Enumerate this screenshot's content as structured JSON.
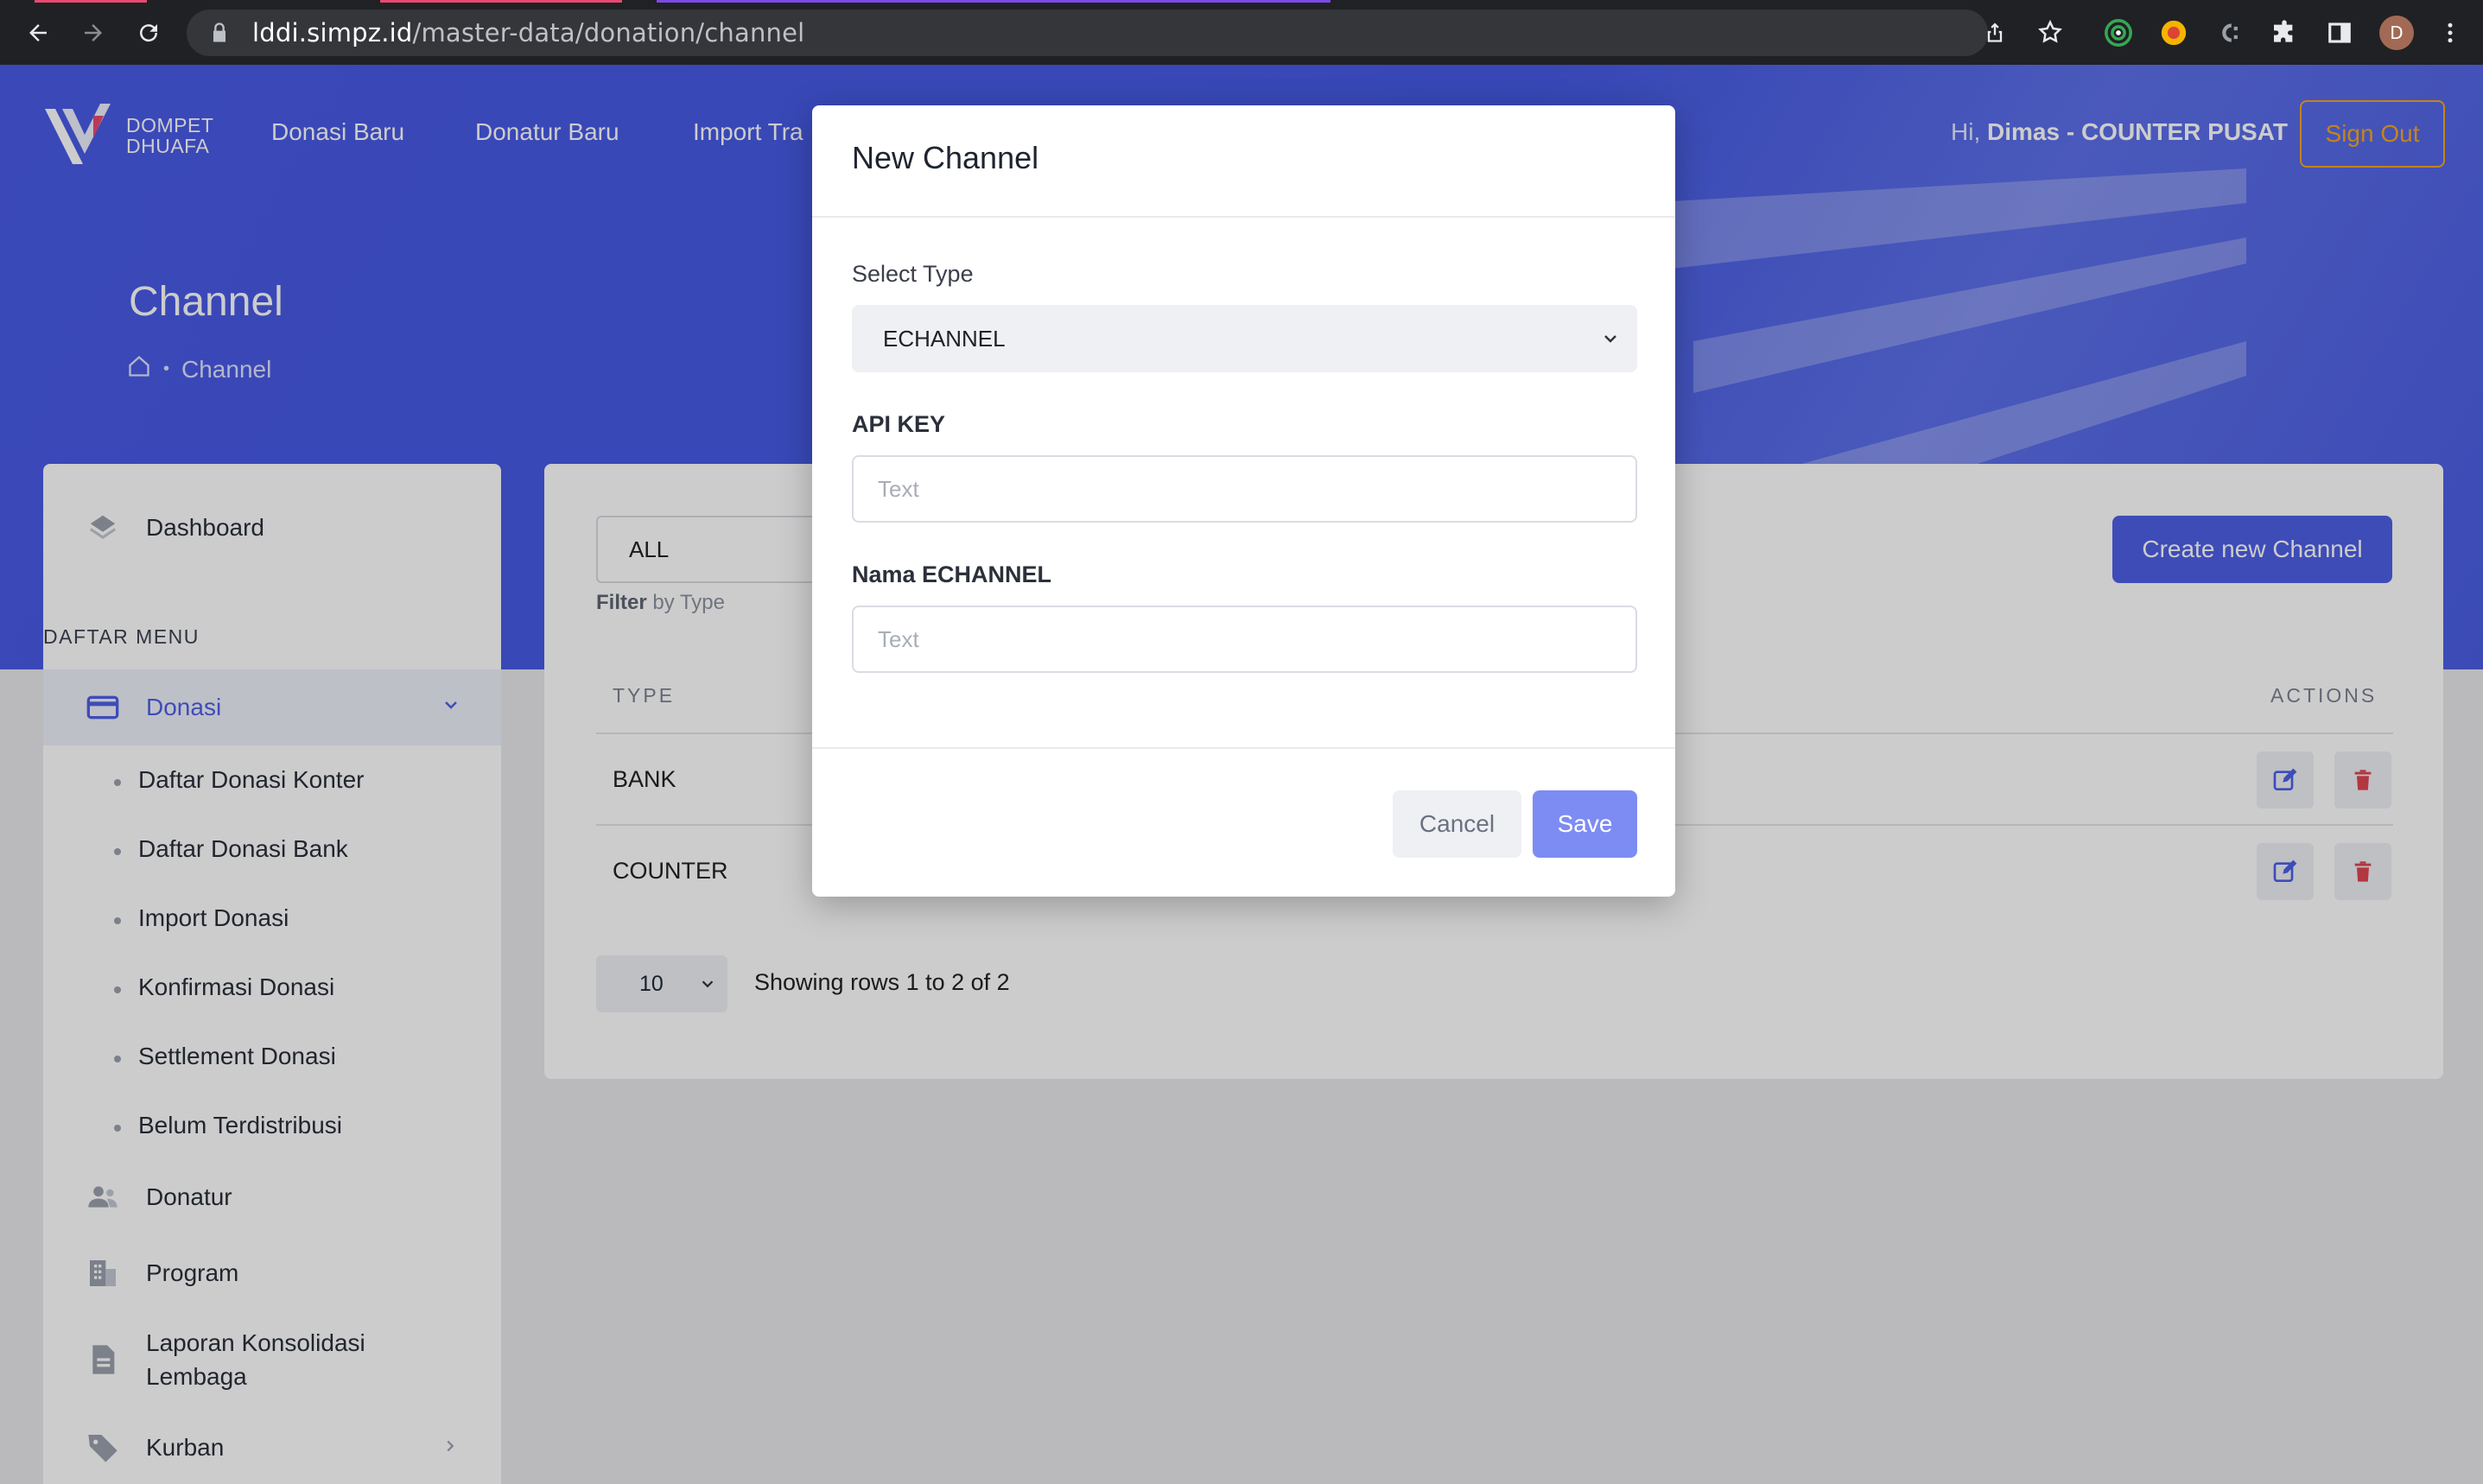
{
  "browser": {
    "url_host": "lddi.simpz.id",
    "url_path": "/master-data/donation/channel",
    "profile_initial": "D"
  },
  "header": {
    "brand_line1": "DOMPET",
    "brand_line2": "DHUAFA",
    "nav": [
      "Donasi Baru",
      "Donatur Baru",
      "Import Tra"
    ],
    "greeting_prefix": "Hi,",
    "greeting_user": "Dimas - COUNTER PUSAT",
    "signout_label": "Sign Out"
  },
  "page": {
    "title": "Channel",
    "breadcrumb": "Channel"
  },
  "sidebar": {
    "dashboard": "Dashboard",
    "section": "DAFTAR MENU",
    "donasi": "Donasi",
    "donasi_sub": [
      "Daftar Donasi Konter",
      "Daftar Donasi Bank",
      "Import Donasi",
      "Konfirmasi Donasi",
      "Settlement Donasi",
      "Belum Terdistribusi"
    ],
    "donatur": "Donatur",
    "program": "Program",
    "laporan_line1": "Laporan Konsolidasi",
    "laporan_line2": "Lembaga",
    "kurban": "Kurban"
  },
  "main": {
    "filter_value": "ALL",
    "filter_help_bold": "Filter",
    "filter_help_rest": "by Type",
    "create_label": "Create new Channel",
    "col_type": "TYPE",
    "col_actions": "ACTIONS",
    "rows": [
      {
        "type": "BANK"
      },
      {
        "type": "COUNTER"
      }
    ],
    "page_size": "10",
    "showing": "Showing rows 1 to 2 of 2"
  },
  "modal": {
    "title": "New Channel",
    "select_label": "Select Type",
    "select_value": "ECHANNEL",
    "api_label": "API KEY",
    "api_placeholder": "Text",
    "name_label": "Nama ECHANNEL",
    "name_placeholder": "Text",
    "cancel_label": "Cancel",
    "save_label": "Save"
  },
  "colors": {
    "primary": "#4e5fe6",
    "accent_orange": "#f5a623",
    "delete_red": "#e0454f"
  }
}
